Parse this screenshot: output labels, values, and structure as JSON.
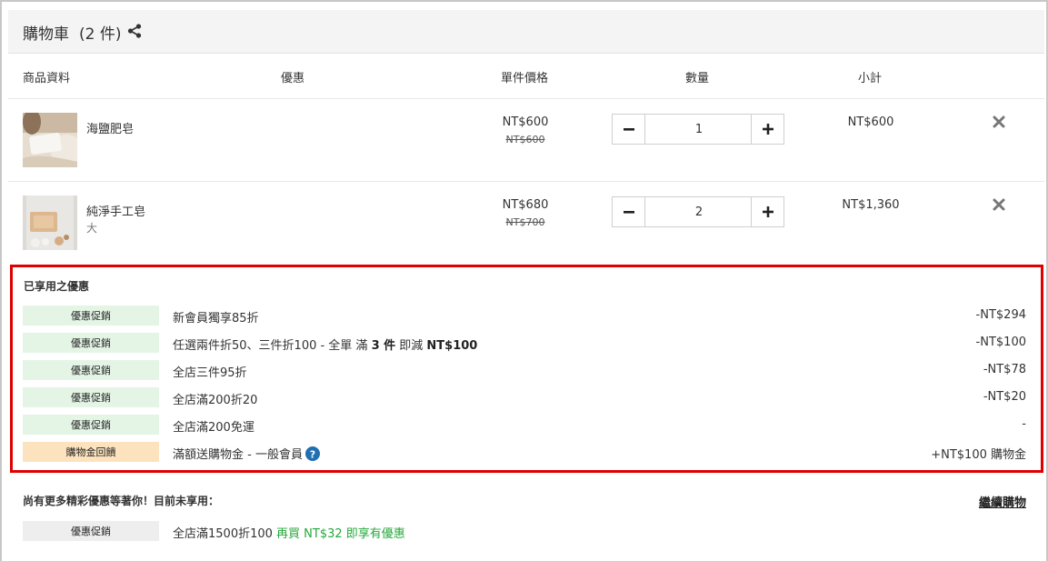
{
  "cart": {
    "title": "購物車",
    "count": "(2 件)"
  },
  "columns": {
    "product": "商品資料",
    "promotion": "優惠",
    "unit_price": "單件價格",
    "quantity": "數量",
    "subtotal": "小計"
  },
  "items": [
    {
      "name": "海鹽肥皂",
      "variant": "",
      "price": "NT$600",
      "old_price": "NT$600",
      "quantity": "1",
      "subtotal": "NT$600"
    },
    {
      "name": "純淨手工皂",
      "variant": "大",
      "price": "NT$680",
      "old_price": "NT$700",
      "quantity": "2",
      "subtotal": "NT$1,360"
    }
  ],
  "applied": {
    "title": "已享用之優惠",
    "rows": [
      {
        "badge": "優惠促銷",
        "text": "新會員獨享85折",
        "amount": "-NT$294"
      },
      {
        "badge": "優惠促銷",
        "text_prefix": "任選兩件折50、三件折100 - 全單 滿 ",
        "text_bold1": "3 件",
        "text_mid": " 即減 ",
        "text_bold2": "NT$100",
        "amount": "-NT$100"
      },
      {
        "badge": "優惠促銷",
        "text": "全店三件95折",
        "amount": "-NT$78"
      },
      {
        "badge": "優惠促銷",
        "text": "全店滿200折20",
        "amount": "-NT$20"
      },
      {
        "badge": "優惠促銷",
        "text": "全店滿200免運",
        "amount": "-"
      },
      {
        "badge": "購物金回饋",
        "text": "滿額送購物金 - 一般會員",
        "amount": "+NT$100 購物金"
      }
    ]
  },
  "more": {
    "title": "尚有更多精彩優惠等著你！目前未享用：",
    "continue_label": "繼續購物",
    "badge": "優惠促銷",
    "text": "全店滿1500折100",
    "hint": "再買 NT$32 即享有優惠"
  },
  "colors": {
    "highlight_border": "#e00000",
    "promo_badge": "#e4f5e6",
    "credit_badge": "#fde3bd",
    "hint_green": "#25a83a",
    "help_blue": "#1f6fb2"
  },
  "icons": {
    "share": "share-icon",
    "minus": "minus-icon",
    "plus": "plus-icon",
    "remove": "close-icon",
    "help": "question-circle-icon"
  }
}
